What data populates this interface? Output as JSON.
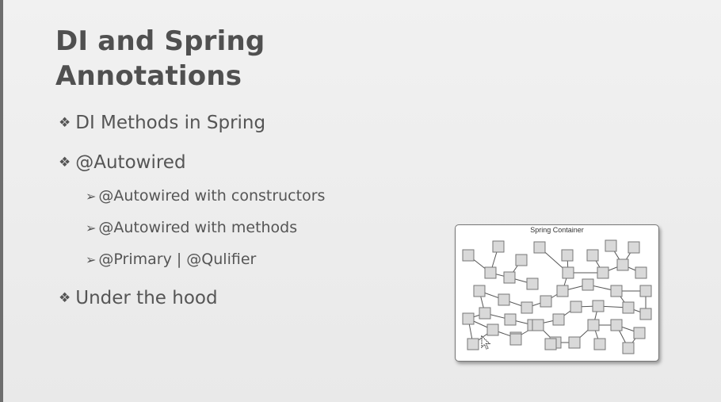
{
  "slide": {
    "title_line1": "DI and Spring",
    "title_line2": "Annotations",
    "bullets": [
      {
        "label": "DI Methods in Spring"
      },
      {
        "label": "@Autowired"
      },
      {
        "label": "Under the hood"
      }
    ],
    "sub_bullets": [
      {
        "label": "@Autowired with constructors"
      },
      {
        "label": "@Autowired with methods"
      },
      {
        "label": "@Primary | @Qulifier"
      }
    ],
    "level1_marker": "❖",
    "level2_marker": "➢"
  },
  "diagram": {
    "title": "Spring Container",
    "node_color": "#d9d9d9",
    "node_border": "#777777",
    "line_color": "#555555"
  }
}
